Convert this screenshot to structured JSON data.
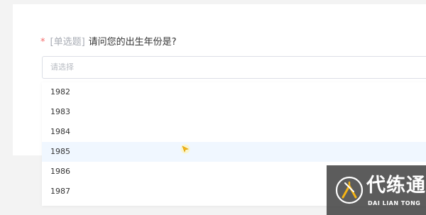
{
  "question": {
    "required_mark": "*",
    "type_label": "[单选题]",
    "title": "请问您的出生年份是?"
  },
  "select": {
    "placeholder": "请选择"
  },
  "dropdown": {
    "options": [
      "1982",
      "1983",
      "1984",
      "1985",
      "1986",
      "1987"
    ],
    "hovered_option": "1985"
  },
  "watermark": {
    "title": "代练通",
    "subtitle": "DAI LIAN TONG",
    "logo_icon": "daliantong-logo-icon"
  },
  "cursor": {
    "icon": "cursor-icon"
  },
  "colors": {
    "required": "#f56c6c",
    "hover_background": "#f0f7ff",
    "border": "#dcdfe6",
    "placeholder": "#b7bbc2",
    "watermark_background": "#464646",
    "logo_accent": "#f5b414"
  }
}
